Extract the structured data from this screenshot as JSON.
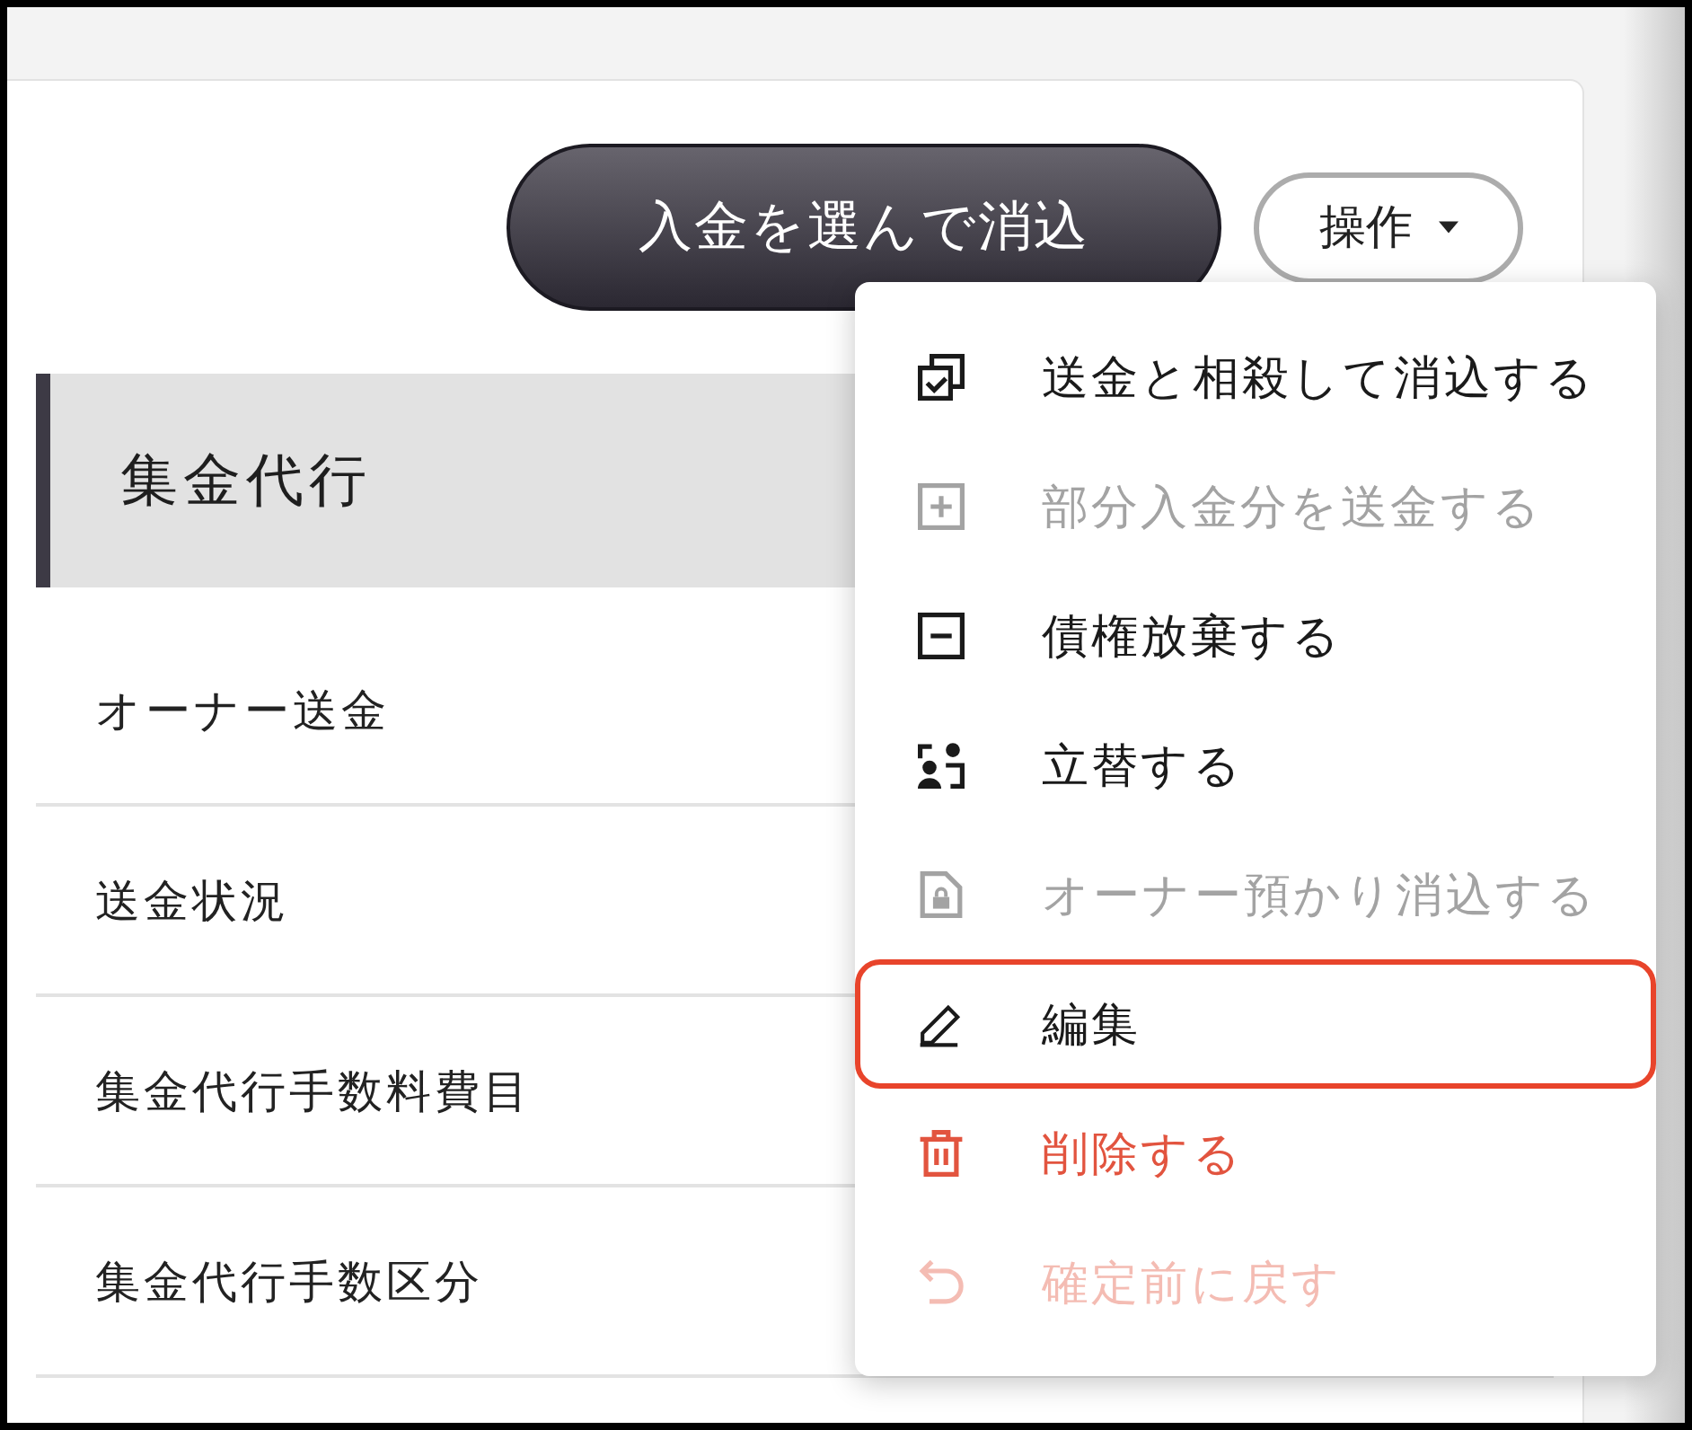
{
  "toolbar": {
    "primary_button": "入金を選んで消込",
    "menu_button": {
      "label": "操作",
      "expanded": true
    }
  },
  "section": {
    "title": "集金代行",
    "rows": [
      "オーナー送金",
      "送金状況",
      "集金代行手数料費目",
      "集金代行手数区分"
    ]
  },
  "menu": {
    "items": [
      {
        "kind": "offset",
        "label": "送金と相殺して消込する",
        "disabled": false,
        "danger": false,
        "highlighted": false
      },
      {
        "kind": "partial",
        "label": "部分入金分を送金する",
        "disabled": true,
        "danger": false,
        "highlighted": false
      },
      {
        "kind": "waive",
        "label": "債権放棄する",
        "disabled": false,
        "danger": false,
        "highlighted": false
      },
      {
        "kind": "advance",
        "label": "立替する",
        "disabled": false,
        "danger": false,
        "highlighted": false
      },
      {
        "kind": "deposit",
        "label": "オーナー預かり消込する",
        "disabled": true,
        "danger": false,
        "highlighted": false
      },
      {
        "kind": "edit",
        "label": "編集",
        "disabled": false,
        "danger": false,
        "highlighted": true
      },
      {
        "kind": "delete",
        "label": "削除する",
        "disabled": false,
        "danger": true,
        "highlighted": false
      },
      {
        "kind": "revert",
        "label": "確定前に戻す",
        "disabled": true,
        "danger": true,
        "highlighted": false
      }
    ]
  }
}
